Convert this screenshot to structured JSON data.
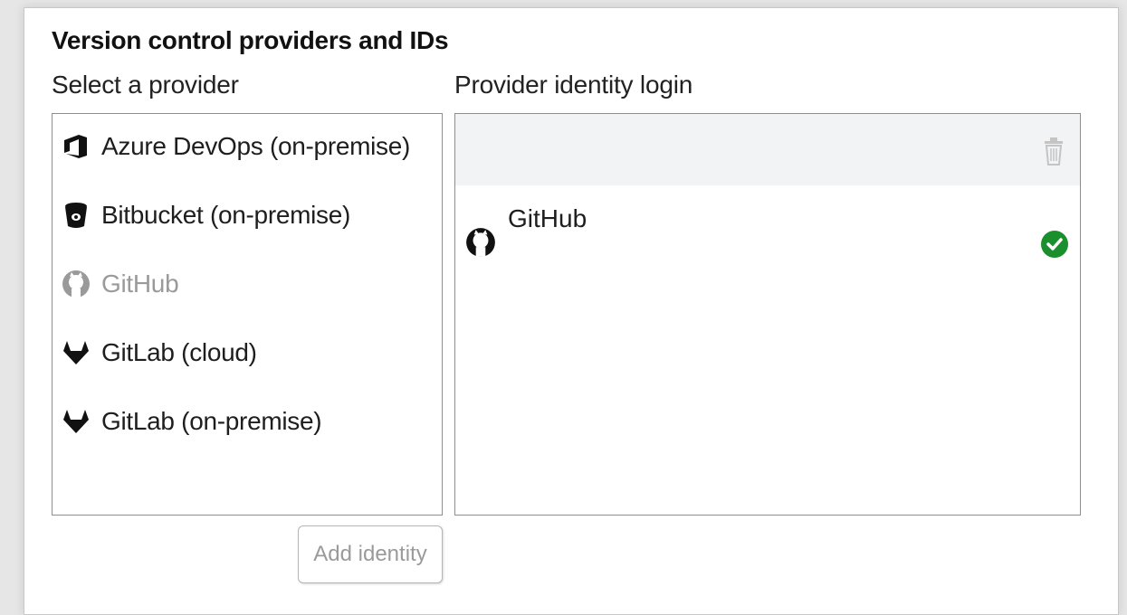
{
  "section": {
    "title": "Version control providers and IDs",
    "select_label": "Select a provider",
    "identity_label": "Provider identity login"
  },
  "providers": [
    {
      "label": "Azure DevOps (on-premise)",
      "icon": "azure-devops-icon",
      "enabled": true
    },
    {
      "label": "Bitbucket (on-premise)",
      "icon": "bitbucket-icon",
      "enabled": true
    },
    {
      "label": "GitHub",
      "icon": "github-icon",
      "enabled": false
    },
    {
      "label": "GitLab (cloud)",
      "icon": "gitlab-icon",
      "enabled": true
    },
    {
      "label": "GitLab (on-premise)",
      "icon": "gitlab-icon",
      "enabled": true
    }
  ],
  "identities": [
    {
      "label": "GitHub",
      "icon": "github-icon",
      "status": "connected",
      "status_icon": "check-circle-icon"
    }
  ],
  "actions": {
    "add_identity_label": "Add identity",
    "delete_icon": "trash-icon"
  },
  "colors": {
    "success": "#1a8f2e",
    "disabled_text": "#9a9a9a",
    "identity_header_bg": "#f1f3f5"
  }
}
